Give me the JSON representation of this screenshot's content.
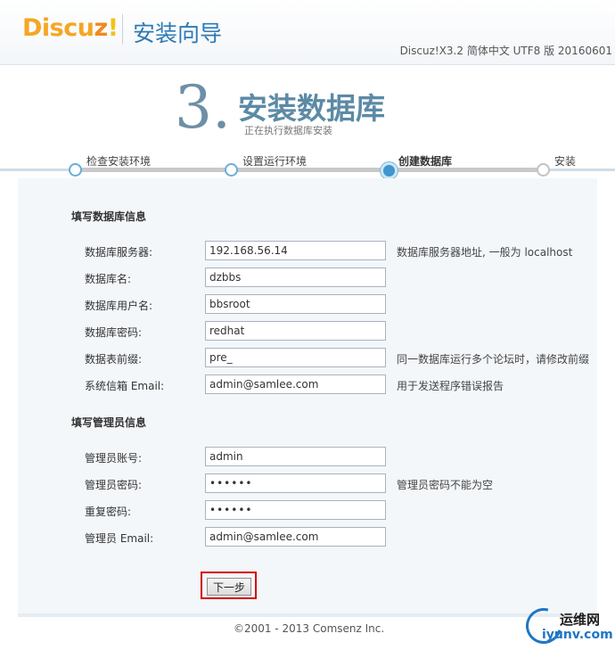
{
  "header": {
    "logo_part1": "Discu",
    "logo_part2": "z",
    "logo_part3": "!",
    "title": "安装向导",
    "version": "Discuz!X3.2 简体中文 UTF8 版 20160601"
  },
  "step": {
    "number": "3.",
    "title": "安装数据库",
    "subtitle": "正在执行数据库安装"
  },
  "progress": {
    "steps": [
      "检查安装环境",
      "设置运行环境",
      "创建数据库",
      "安装"
    ],
    "current_index": 2
  },
  "db_section": {
    "title": "填写数据库信息",
    "rows": [
      {
        "label": "数据库服务器:",
        "value": "192.168.56.14",
        "hint": "数据库服务器地址, 一般为 localhost"
      },
      {
        "label": "数据库名:",
        "value": "dzbbs",
        "hint": ""
      },
      {
        "label": "数据库用户名:",
        "value": "bbsroot",
        "hint": ""
      },
      {
        "label": "数据库密码:",
        "value": "redhat",
        "hint": ""
      },
      {
        "label": "数据表前缀:",
        "value": "pre_",
        "hint": "同一数据库运行多个论坛时，请修改前缀"
      },
      {
        "label": "系统信箱 Email:",
        "value": "admin@samlee.com",
        "hint": "用于发送程序错误报告"
      }
    ]
  },
  "admin_section": {
    "title": "填写管理员信息",
    "rows": [
      {
        "label": "管理员账号:",
        "value": "admin",
        "hint": ""
      },
      {
        "label": "管理员密码:",
        "value": "••••••",
        "hint": "管理员密码不能为空"
      },
      {
        "label": "重复密码:",
        "value": "••••••",
        "hint": ""
      },
      {
        "label": "管理员 Email:",
        "value": "admin@samlee.com",
        "hint": ""
      }
    ]
  },
  "actions": {
    "next_label": "下一步"
  },
  "footer": {
    "copyright": "©2001 - 2013 Comsenz Inc."
  },
  "watermark": {
    "cn": "运维网",
    "en": "iyunv.com"
  },
  "colors": {
    "accent_blue": "#2e7ab6",
    "logo_orange": "#f5a623",
    "highlight_red": "#d40000"
  }
}
